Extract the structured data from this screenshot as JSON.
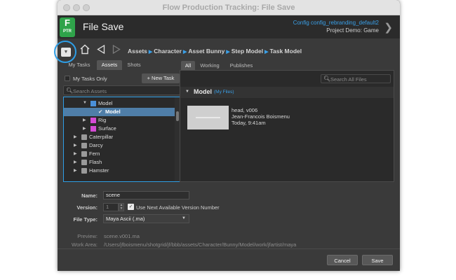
{
  "window": {
    "title": "Flow Production Tracking: File Save"
  },
  "header": {
    "logo_letter": "F",
    "logo_sub": "PTR",
    "app_title": "File Save",
    "config": "Config config_rebranding_default2",
    "project": "Project Demo: Game"
  },
  "nav": {
    "breadcrumb": [
      "Assets",
      "Character",
      "Asset Bunny",
      "Step Model",
      "Task Model"
    ]
  },
  "left_panel": {
    "tabs": [
      "My Tasks",
      "Assets",
      "Shots"
    ],
    "active_tab": "Assets",
    "my_tasks_only_label": "My Tasks Only",
    "new_task_label": "+ New Task",
    "search_placeholder": "Search Assets",
    "tree": [
      {
        "label": "Model",
        "type": "step",
        "expanded": true,
        "color": "#4a90d9"
      },
      {
        "label": "Model",
        "type": "task",
        "selected": true
      },
      {
        "label": "Rig",
        "type": "step",
        "expanded": false,
        "color": "#d44bd4"
      },
      {
        "label": "Surface",
        "type": "step",
        "expanded": false,
        "color": "#d44bd4"
      },
      {
        "label": "Caterpillar",
        "type": "asset"
      },
      {
        "label": "Darcy",
        "type": "asset"
      },
      {
        "label": "Fern",
        "type": "asset"
      },
      {
        "label": "Flash",
        "type": "asset"
      },
      {
        "label": "Hamster",
        "type": "asset"
      }
    ]
  },
  "right_panel": {
    "tabs": [
      "All",
      "Working",
      "Publishes"
    ],
    "active_tab": "All",
    "search_placeholder": "Search All Files",
    "section_title": "Model",
    "section_tag": "(My Files)",
    "file": {
      "name": "head, v006",
      "user": "Jean-Francois Boismenu",
      "time": "Today, 9:41am"
    }
  },
  "form": {
    "name_label": "Name:",
    "name_value": "scene",
    "version_label": "Version:",
    "version_value": "1",
    "use_next_label": "Use Next Available Version Number",
    "filetype_label": "File Type:",
    "filetype_value": "Maya Ascii (.ma)",
    "preview_label": "Preview:",
    "preview_value": "scene.v001.ma",
    "workarea_label": "Work Area:",
    "workarea_value": "/Users/jfboismenu/shotgrid/jf/bbb/assets/Character/Bunny/Model/work/jfartist/maya"
  },
  "buttons": {
    "cancel": "Cancel",
    "save": "Save"
  },
  "colors": {
    "accent": "#2e9ee6",
    "logo": "#2fa34a",
    "selection": "#4f7ea8"
  }
}
